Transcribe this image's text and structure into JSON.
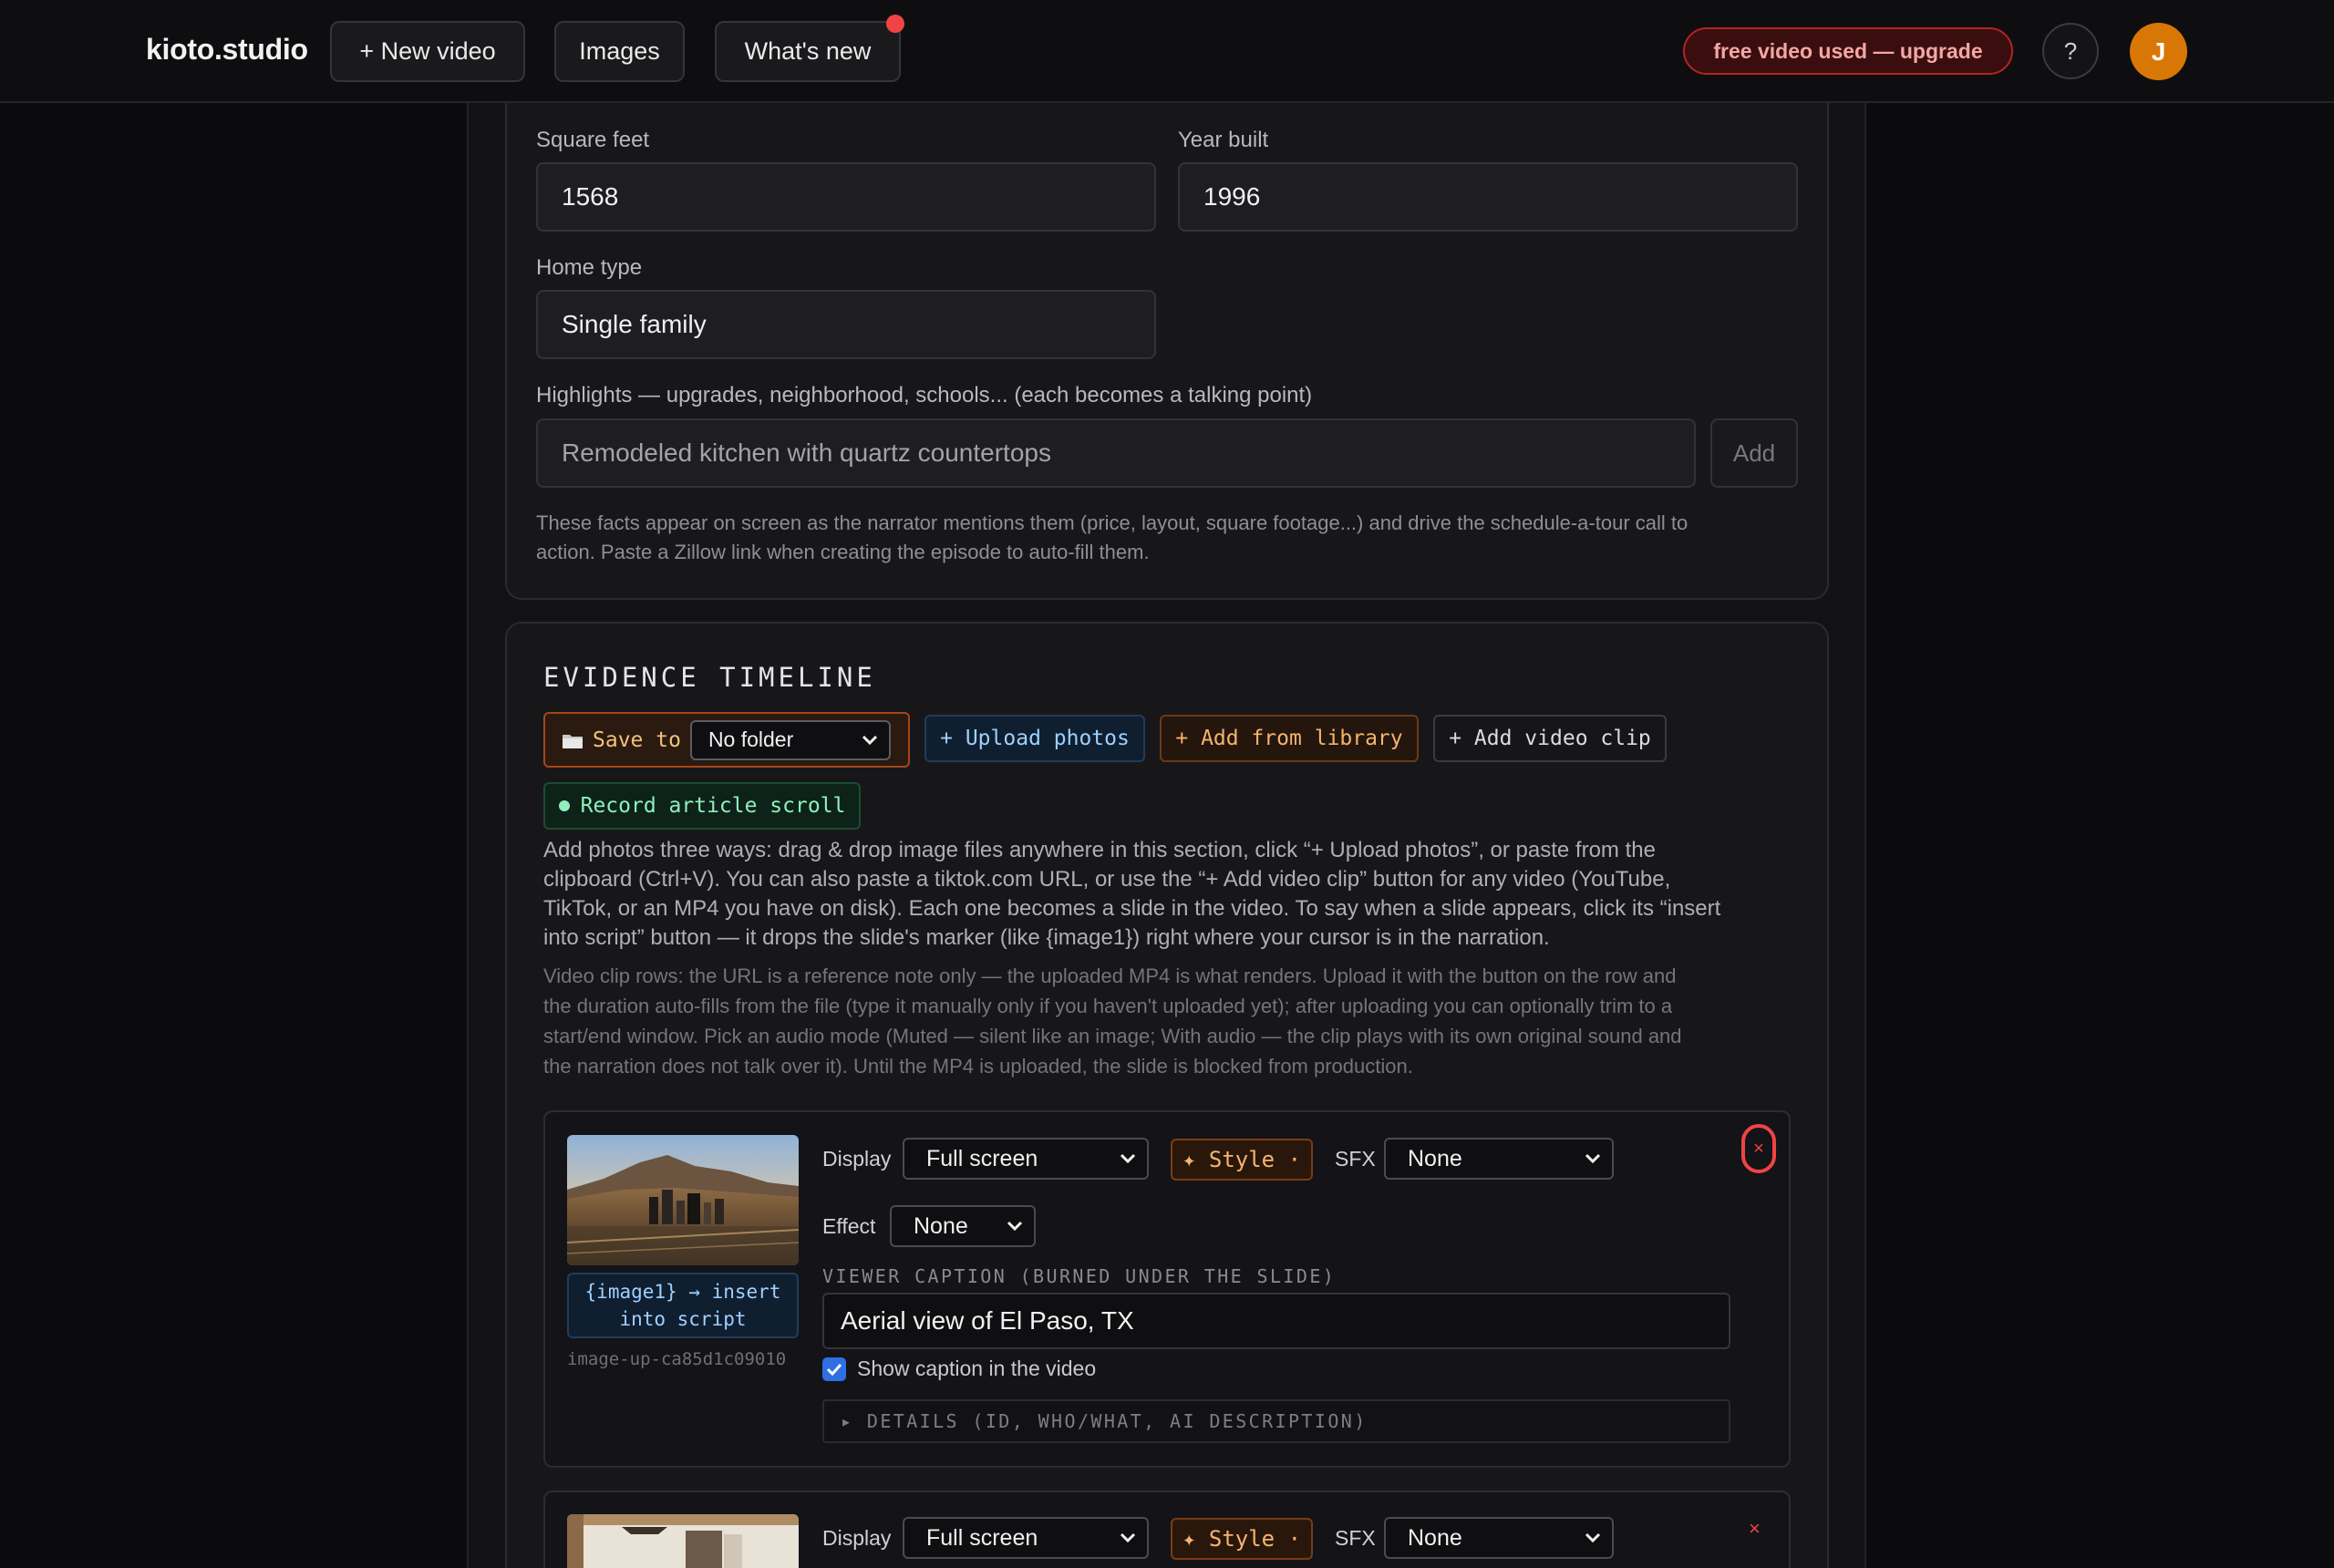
{
  "topbar": {
    "brand": "kioto.studio",
    "new_video": "+ New video",
    "images": "Images",
    "whats_new": "What's new",
    "upgrade": "free video used — upgrade",
    "help": "?",
    "avatar_initial": "J"
  },
  "property": {
    "square_feet_label": "Square feet",
    "square_feet_value": "1568",
    "year_built_label": "Year built",
    "year_built_value": "1996",
    "home_type_label": "Home type",
    "home_type_value": "Single family",
    "highlights_label": "Highlights — upgrades, neighborhood, schools... (each becomes a talking point)",
    "highlights_placeholder": "Remodeled kitchen with quartz countertops",
    "add_label": "Add",
    "hint_line1": "These facts appear on screen as the narrator mentions them (price, layout, square footage...) and drive the schedule-a-tour call to",
    "hint_line2": "action. Paste a Zillow link when creating the episode to auto-fill them."
  },
  "evidence": {
    "title": "EVIDENCE TIMELINE",
    "save_to": "Save to",
    "folder_value": "No folder",
    "upload_photos": "+ Upload photos",
    "add_from_library": "+ Add from library",
    "add_video_clip": "+ Add video clip",
    "record_scroll": "Record article scroll",
    "desc1": [
      "Add photos three ways: drag & drop image files anywhere in this section, click “+ Upload photos”, or paste from the",
      "clipboard (Ctrl+V). You can also paste a tiktok.com URL, or use the “+ Add video clip” button for any video (YouTube,",
      "TikTok, or an MP4 you have on disk). Each one becomes a slide in the video. To say when a slide appears, click its “insert",
      "into script” button — it drops the slide's marker (like {image1}) right where your cursor is in the narration."
    ],
    "desc2": [
      "Video clip rows: the URL is a reference note only — the uploaded MP4 is what renders. Upload it with the button on the row and",
      "the duration auto-fills from the file (type it manually only if you haven't uploaded yet); after uploading you can optionally trim to a",
      "start/end window. Pick an audio mode (Muted — silent like an image; With audio — the clip plays with its own original sound and",
      "the narration does not talk over it). Until the MP4 is uploaded, the slide is blocked from production."
    ]
  },
  "slides": [
    {
      "display_label": "Display",
      "display_value": "Full screen",
      "style_label": "✦ Style ·",
      "sfx_label": "SFX",
      "sfx_value": "None",
      "effect_label": "Effect",
      "effect_value": "None",
      "insert_line1": "{image1} → insert",
      "insert_line2": "into script",
      "image_id": "image-up-ca85d1c09010",
      "caption_label": "VIEWER CAPTION (BURNED UNDER THE SLIDE)",
      "caption_value": "Aerial view of El Paso, TX",
      "show_caption": "Show caption in the video",
      "details": "▸ DETAILS (ID, WHO/WHAT, AI DESCRIPTION)",
      "remove": "×"
    },
    {
      "display_label": "Display",
      "display_value": "Full screen",
      "style_label": "✦ Style ·",
      "sfx_label": "SFX",
      "sfx_value": "None",
      "remove": "×"
    }
  ],
  "colors": {
    "accent_orange": "#d97706",
    "danger": "#ef4444",
    "link_blue": "#9fd0ff",
    "record_green": "#8ff0bd"
  }
}
